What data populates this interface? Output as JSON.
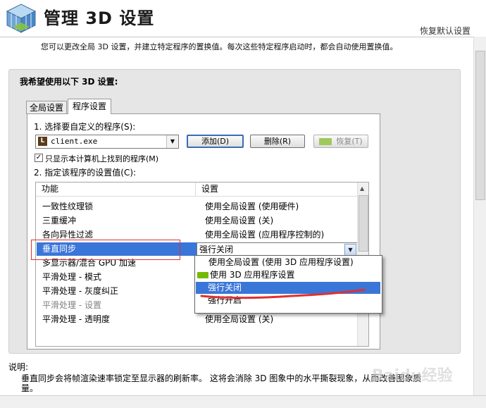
{
  "header": {
    "title": "管理 3D 设置",
    "restore_defaults": "恢复默认设置",
    "description": "您可以更改全局 3D 设置，并建立特定程序的置换值。每次这些特定程序启动时，都会自动使用置换值。"
  },
  "panel": {
    "title": "我希望使用以下 3D 设置:",
    "tabs": [
      {
        "label": "全局设置",
        "active": false
      },
      {
        "label": "程序设置",
        "active": true
      }
    ],
    "step1_label": "1. 选择要自定义的程序(S):",
    "program_select": {
      "value": "client.exe"
    },
    "buttons": {
      "add": "添加(D)",
      "remove": "删除(R)",
      "restore": "恢复(T)"
    },
    "checkbox": {
      "label": "只显示本计算机上找到的程序(M)",
      "checked": true
    },
    "step2_label": "2. 指定该程序的设置值(C):"
  },
  "settings_table": {
    "columns": [
      "功能",
      "设置"
    ],
    "rows": [
      {
        "feature": "一致性纹理锁",
        "setting": "使用全局设置 (使用硬件)"
      },
      {
        "feature": "三重缓冲",
        "setting": "使用全局设置 (关)"
      },
      {
        "feature": "各向异性过滤",
        "setting": "使用全局设置 (应用程序控制的)"
      },
      {
        "feature": "垂直同步",
        "setting": "强行关闭",
        "selected": true
      },
      {
        "feature": "多显示器/混合 GPU 加速",
        "setting": ""
      },
      {
        "feature": "平滑处理 - 模式",
        "setting": ""
      },
      {
        "feature": "平滑处理 - 灰度纠正",
        "setting": ""
      },
      {
        "feature": "平滑处理 - 设置",
        "setting": "",
        "disabled": true
      },
      {
        "feature": "平滑处理 - 透明度",
        "setting": "使用全局设置 (关)"
      }
    ]
  },
  "dropdown": {
    "options": [
      {
        "label": "使用全局设置 (使用 3D 应用程序设置)"
      },
      {
        "label": "使用 3D 应用程序设置",
        "icon": "nvidia-icon"
      },
      {
        "label": "强行关闭",
        "highlighted": true
      },
      {
        "label": "强行开启"
      }
    ]
  },
  "description": {
    "label": "说明:",
    "text": "垂直同步会将帧渲染速率锁定至显示器的刷新率。 这将会消除 3D 图象中的水平撕裂现象，从而改善图象质量。"
  },
  "watermark": "Baidu经验",
  "colors": {
    "selection": "#3a76d8",
    "annotation_red": "#e03030",
    "nvidia_green": "#76b900"
  }
}
